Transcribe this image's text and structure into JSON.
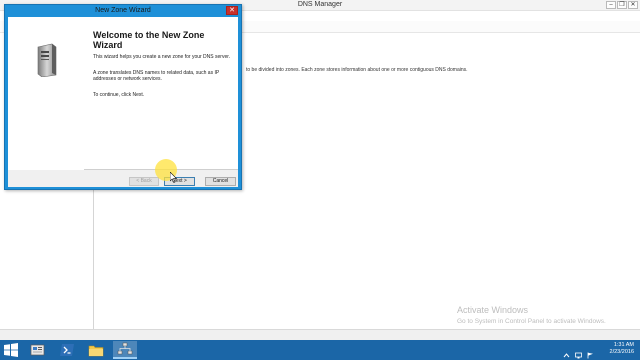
{
  "mmc": {
    "title": "DNS Manager",
    "description": "to be divided into zones. Each zone stores information about one or more contiguous DNS domains."
  },
  "watermark": {
    "title": "Activate Windows",
    "subtitle": "Go to System in Control Panel to activate Windows."
  },
  "wizard": {
    "title": "New Zone Wizard",
    "close_label": "✕",
    "heading": "Welcome to the New Zone Wizard",
    "paragraph1": "This wizard helps you create a new zone for your DNS server.",
    "paragraph2": "A zone translates DNS names to related data, such as IP addresses or network services.",
    "paragraph3": "To continue, click Next.",
    "buttons": {
      "back": "< Back",
      "next": "Next >",
      "cancel": "Cancel"
    }
  },
  "taskbar": {
    "items": [
      "start-icon",
      "server-manager-icon",
      "powershell-icon",
      "file-explorer-icon",
      "dns-manager-icon"
    ],
    "active_item": "dns-manager-icon",
    "time": "1:31 AM",
    "date": "2/23/2016"
  },
  "colors": {
    "wizard_frame": "#1e90d8",
    "taskbar": "#1b66a7",
    "close_button": "#c9302c",
    "cursor_highlight": "#ffe23c"
  }
}
